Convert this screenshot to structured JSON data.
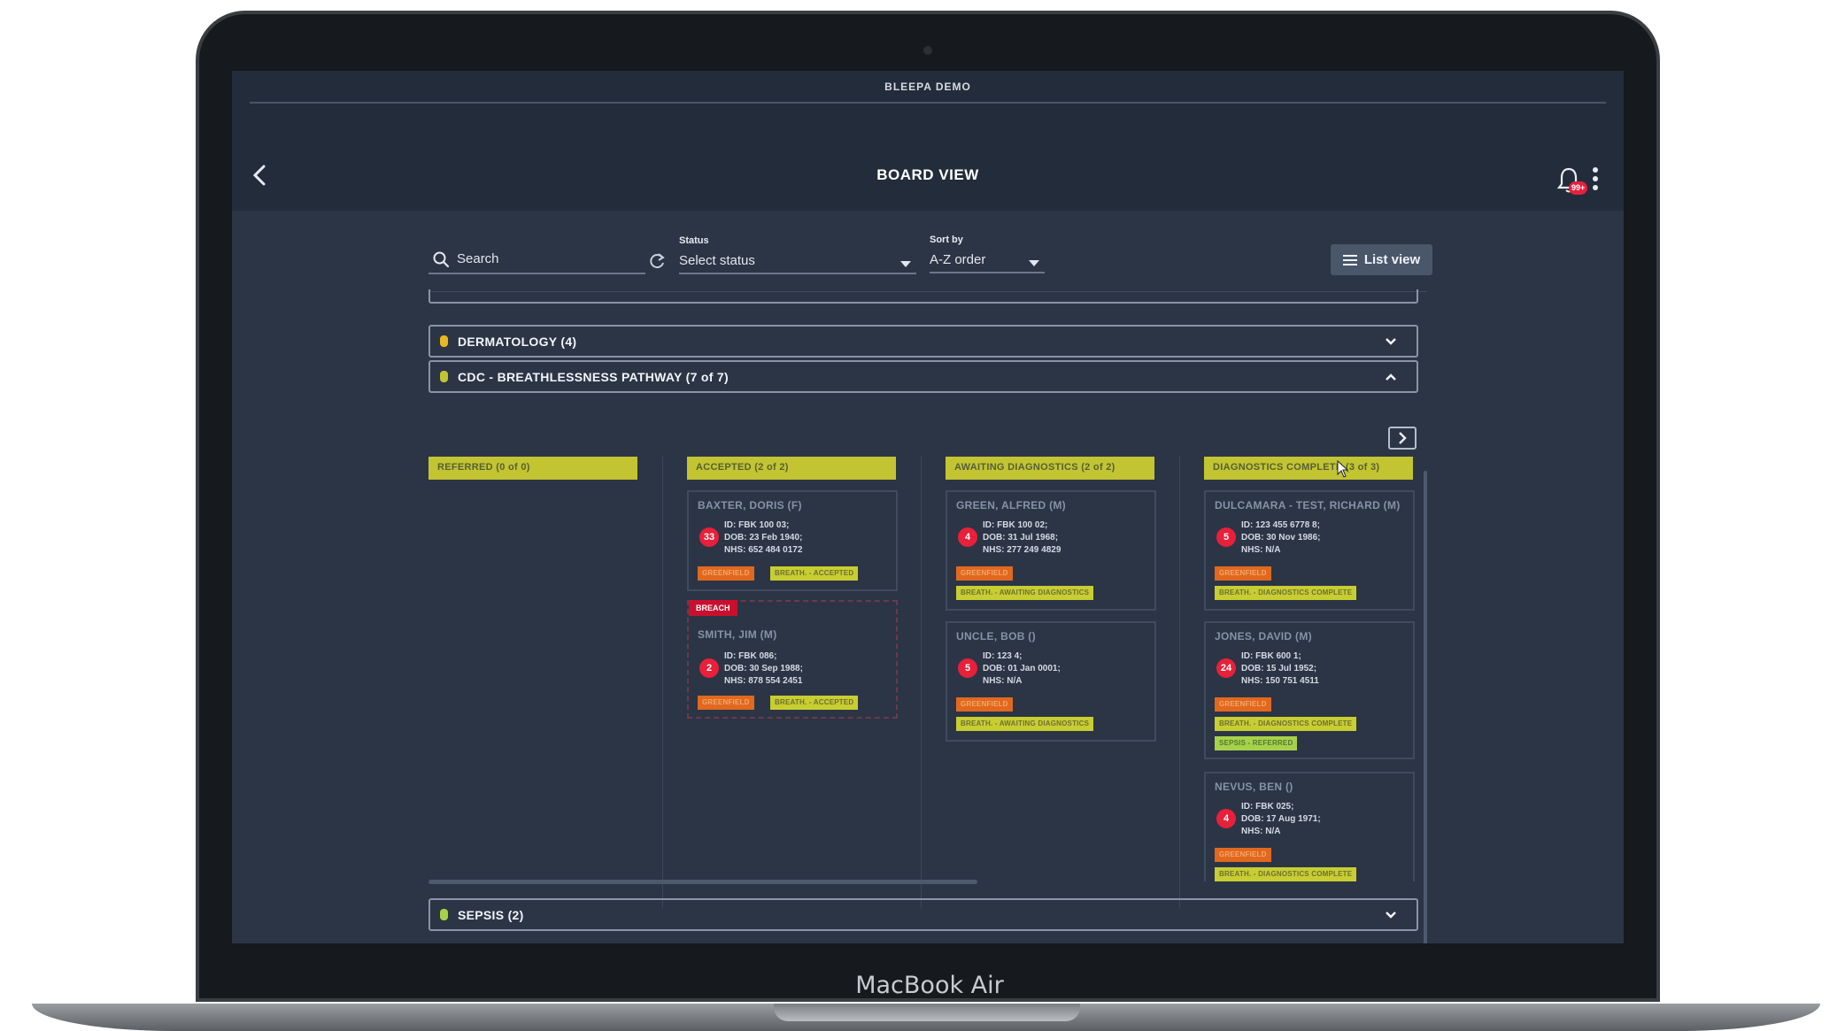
{
  "device": {
    "brand": "MacBook Air"
  },
  "app": {
    "name": "BLEEPA DEMO",
    "page_title": "BOARD VIEW",
    "notification_count": "99+"
  },
  "toolbar": {
    "search_placeholder": "Search",
    "status_label": "Status",
    "status_value": "Select status",
    "sort_label": "Sort by",
    "sort_value": "A-Z order",
    "list_view_label": "List view"
  },
  "groups": {
    "dermatology": {
      "title": "DERMATOLOGY (4)",
      "dot_color": "#e8b820",
      "expanded": false
    },
    "cdc": {
      "title": "CDC - BREATHLESSNESS PATHWAY (7 of 7)",
      "dot_color": "#c3c432",
      "expanded": true
    },
    "sepsis": {
      "title": "SEPSIS (2)",
      "dot_color": "#a8d14a",
      "expanded": false
    }
  },
  "columns": [
    {
      "title": "REFERRED (0 of 0)"
    },
    {
      "title": "ACCEPTED (2 of 2)"
    },
    {
      "title": "AWAITING DIAGNOSTICS (2 of 2)"
    },
    {
      "title": "DIAGNOSTICS COMPLETE (3 of 3)"
    }
  ],
  "cards": {
    "baxter": {
      "name": "BAXTER, DORIS (F)",
      "badge": "33",
      "id": "ID: FBK 100 03;",
      "dob": "DOB: 23 Feb 1940;",
      "nhs": "NHS: 652 484 0172",
      "tag1": "GREENFIELD",
      "tag2": "BREATH. - ACCEPTED"
    },
    "smith": {
      "breach": "BREACH",
      "name": "SMITH, JIM (M)",
      "badge": "2",
      "id": "ID: FBK 086;",
      "dob": "DOB: 30 Sep 1988;",
      "nhs": "NHS: 878 554 2451",
      "tag1": "GREENFIELD",
      "tag2": "BREATH. - ACCEPTED"
    },
    "green": {
      "name": "GREEN, ALFRED (M)",
      "badge": "4",
      "id": "ID: FBK 100 02;",
      "dob": "DOB: 31 Jul 1968;",
      "nhs": "NHS: 277 249 4829",
      "tag1": "GREENFIELD",
      "tag2": "BREATH. - AWAITING DIAGNOSTICS"
    },
    "uncle": {
      "name": "UNCLE, BOB ()",
      "badge": "5",
      "id": "ID: 123 4;",
      "dob": "DOB: 01 Jan 0001;",
      "nhs": "NHS: N/A",
      "tag1": "GREENFIELD",
      "tag2": "BREATH. - AWAITING DIAGNOSTICS"
    },
    "dulcamara": {
      "name": "DULCAMARA - TEST, RICHARD (M)",
      "badge": "5",
      "id": "ID: 123 455 6778 8;",
      "dob": "DOB: 30 Nov 1986;",
      "nhs": "NHS: N/A",
      "tag1": "GREENFIELD",
      "tag2": "BREATH. - DIAGNOSTICS COMPLETE"
    },
    "jones": {
      "name": "JONES, DAVID (M)",
      "badge": "24",
      "id": "ID: FBK 600 1;",
      "dob": "DOB: 15 Jul 1952;",
      "nhs": "NHS: 150 751 4511",
      "tag1": "GREENFIELD",
      "tag2": "BREATH. - DIAGNOSTICS COMPLETE",
      "tag3": "SEPSIS - REFERRED"
    },
    "nevus": {
      "name": "NEVUS, BEN ()",
      "badge": "4",
      "id": "ID: FBK 025;",
      "dob": "DOB: 17 Aug 1971;",
      "nhs": "NHS: N/A",
      "tag1": "GREENFIELD",
      "tag2": "BREATH. - DIAGNOSTICS COMPLETE"
    }
  }
}
